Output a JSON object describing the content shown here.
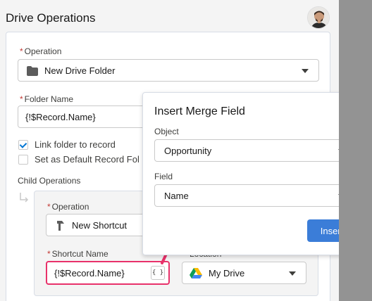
{
  "page": {
    "title": "Drive Operations"
  },
  "operation": {
    "required_mark": "*",
    "label": "Operation",
    "value": "New Drive Folder",
    "icon": "folder-icon"
  },
  "folder_name": {
    "required_mark": "*",
    "label": "Folder Name",
    "value": "{!$Record.Name}"
  },
  "checkboxes": {
    "link_folder": {
      "label": "Link folder to record",
      "checked": true
    },
    "default_folder": {
      "label": "Set as Default Record Fol",
      "checked": false
    }
  },
  "child_operations": {
    "label": "Child Operations",
    "operation": {
      "required_mark": "*",
      "label": "Operation",
      "value": "New Shortcut",
      "icon": "shortcut-arrow-icon"
    },
    "shortcut_name": {
      "required_mark": "*",
      "label": "Shortcut Name",
      "value": "{!$Record.Name}",
      "merge_button": "{ }"
    },
    "location": {
      "label": "Location",
      "value": "My Drive",
      "icon": "google-drive-icon"
    }
  },
  "popover": {
    "title": "Insert Merge Field",
    "object": {
      "label": "Object",
      "value": "Opportunity"
    },
    "field": {
      "label": "Field",
      "value": "Name"
    },
    "insert_label": "Insert"
  },
  "colors": {
    "highlight": "#e8316a",
    "brand": "#3b7dd8",
    "right_gutter": "#939393"
  }
}
